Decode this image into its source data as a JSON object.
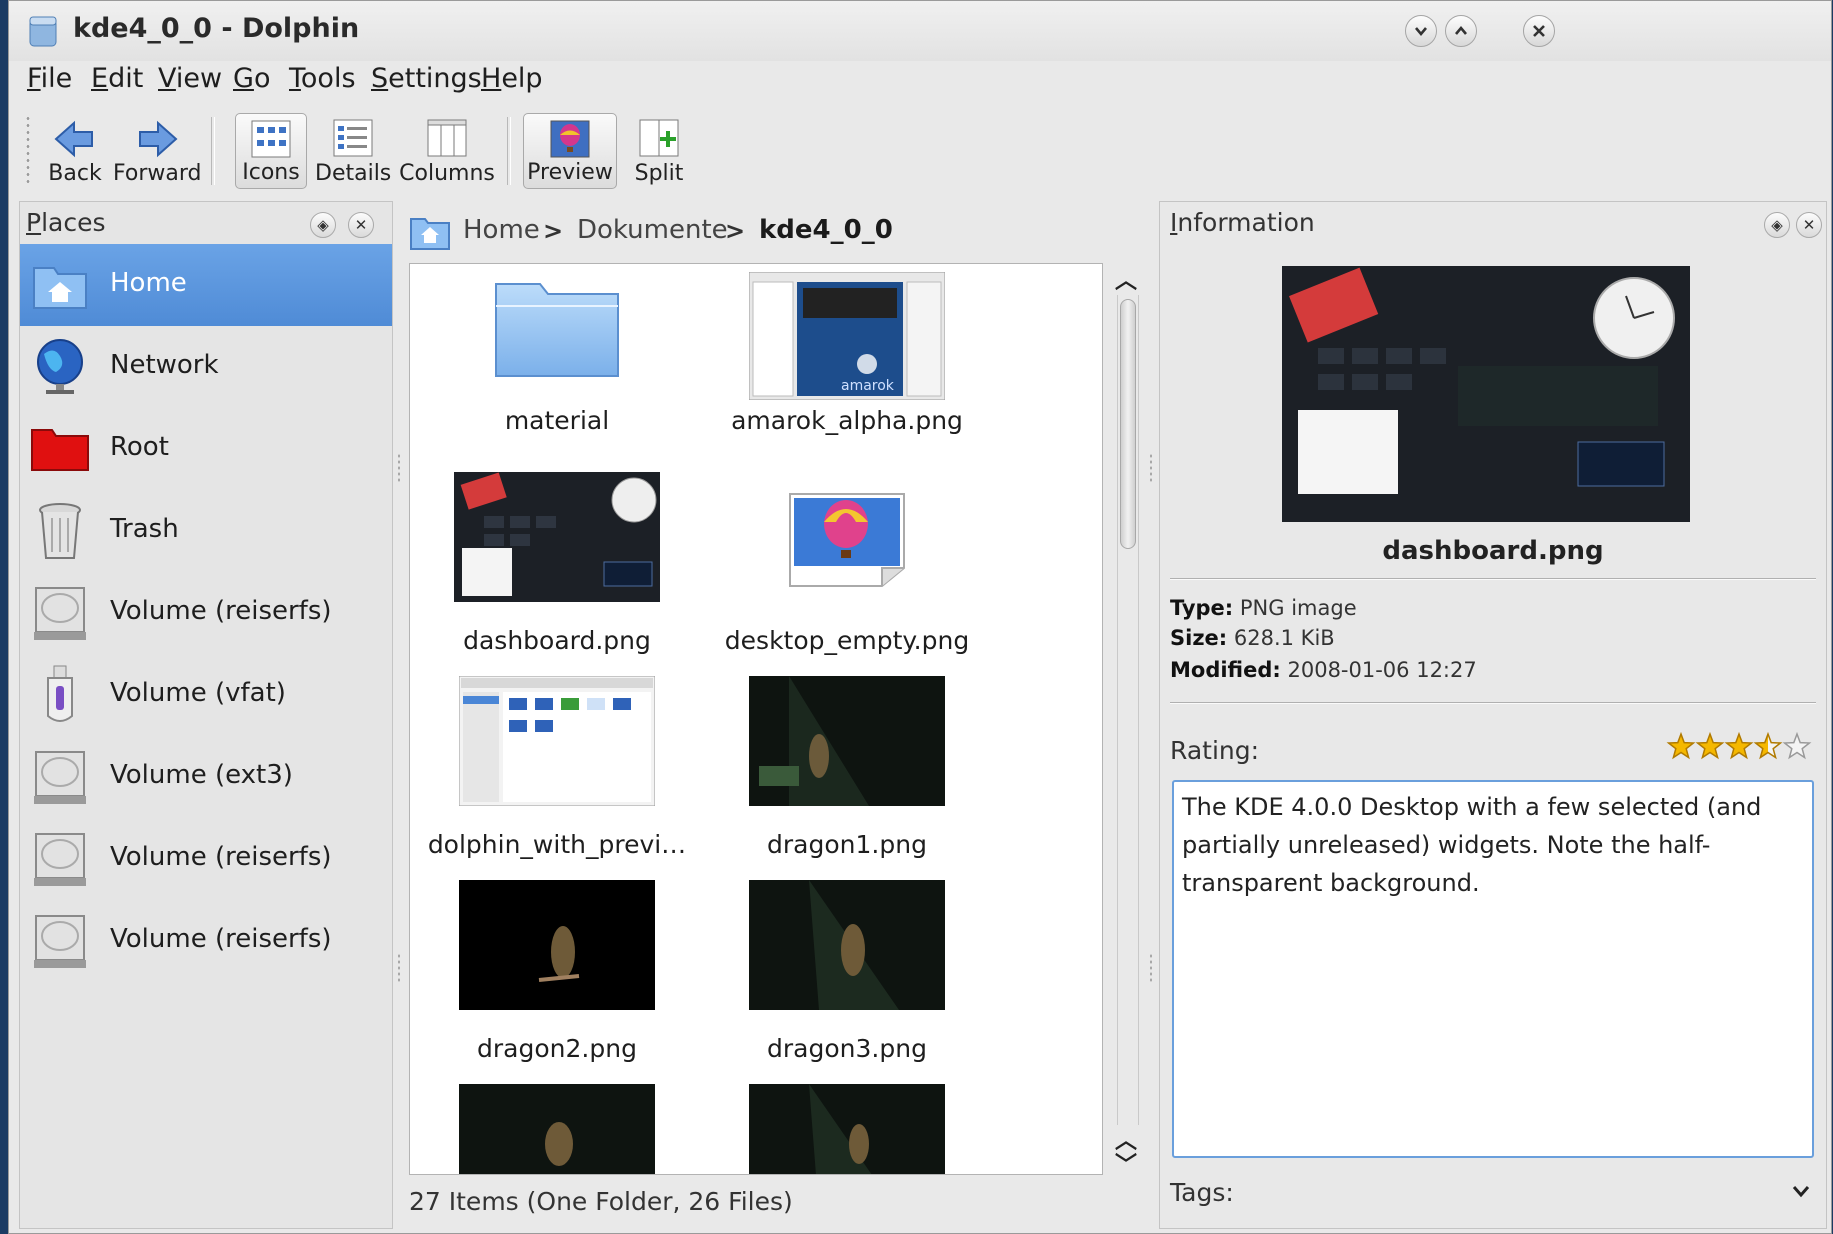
{
  "window": {
    "title": "kde4_0_0 - Dolphin"
  },
  "menubar": [
    "File",
    "Edit",
    "View",
    "Go",
    "Tools",
    "Settings",
    "Help"
  ],
  "toolbar": {
    "back": "Back",
    "forward": "Forward",
    "icons": "Icons",
    "details": "Details",
    "columns": "Columns",
    "preview": "Preview",
    "split": "Split"
  },
  "places": {
    "title": "Places",
    "items": [
      {
        "label": "Home",
        "icon": "home-folder-icon",
        "selected": true
      },
      {
        "label": "Network",
        "icon": "network-globe-icon"
      },
      {
        "label": "Root",
        "icon": "root-folder-icon"
      },
      {
        "label": "Trash",
        "icon": "trash-icon"
      },
      {
        "label": "Volume (reiserfs)",
        "icon": "hard-drive-icon"
      },
      {
        "label": "Volume (vfat)",
        "icon": "usb-stick-icon"
      },
      {
        "label": "Volume (ext3)",
        "icon": "hard-drive-icon"
      },
      {
        "label": "Volume (reiserfs)",
        "icon": "hard-drive-icon"
      },
      {
        "label": "Volume (reiserfs)",
        "icon": "hard-drive-icon"
      }
    ]
  },
  "breadcrumb": {
    "items": [
      "Home",
      "Dokumente",
      "kde4_0_0"
    ]
  },
  "files": [
    {
      "name": "material",
      "kind": "folder"
    },
    {
      "name": "amarok_alpha.png",
      "kind": "screenshot"
    },
    {
      "name": "dashboard.png",
      "kind": "dark-screenshot"
    },
    {
      "name": "desktop_empty.png",
      "kind": "balloon"
    },
    {
      "name": "dolphin_with_previ…",
      "kind": "light-screenshot"
    },
    {
      "name": "dragon1.png",
      "kind": "dragon"
    },
    {
      "name": "dragon2.png",
      "kind": "dragon"
    },
    {
      "name": "dragon3.png",
      "kind": "dragon"
    },
    {
      "name": "",
      "kind": "dragon"
    },
    {
      "name": "",
      "kind": "dragon"
    }
  ],
  "status": "27 Items (One Folder, 26 Files)",
  "information": {
    "title": "Information",
    "file_name": "dashboard.png",
    "type_label": "Type:",
    "type_value": "PNG image",
    "size_label": "Size:",
    "size_value": "628.1 KiB",
    "modified_label": "Modified:",
    "modified_value": "2008-01-06 12:27",
    "rating_label": "Rating:",
    "rating": 3.5,
    "rating_max": 5,
    "comment": "The KDE 4.0.0 Desktop with a few selected (and partially unreleased) widgets. Note the half-transparent background.",
    "tags_label": "Tags:"
  },
  "colors": {
    "selection": "#5b95dc",
    "star": "#f5b800",
    "comment_border": "#6a9fdc"
  }
}
